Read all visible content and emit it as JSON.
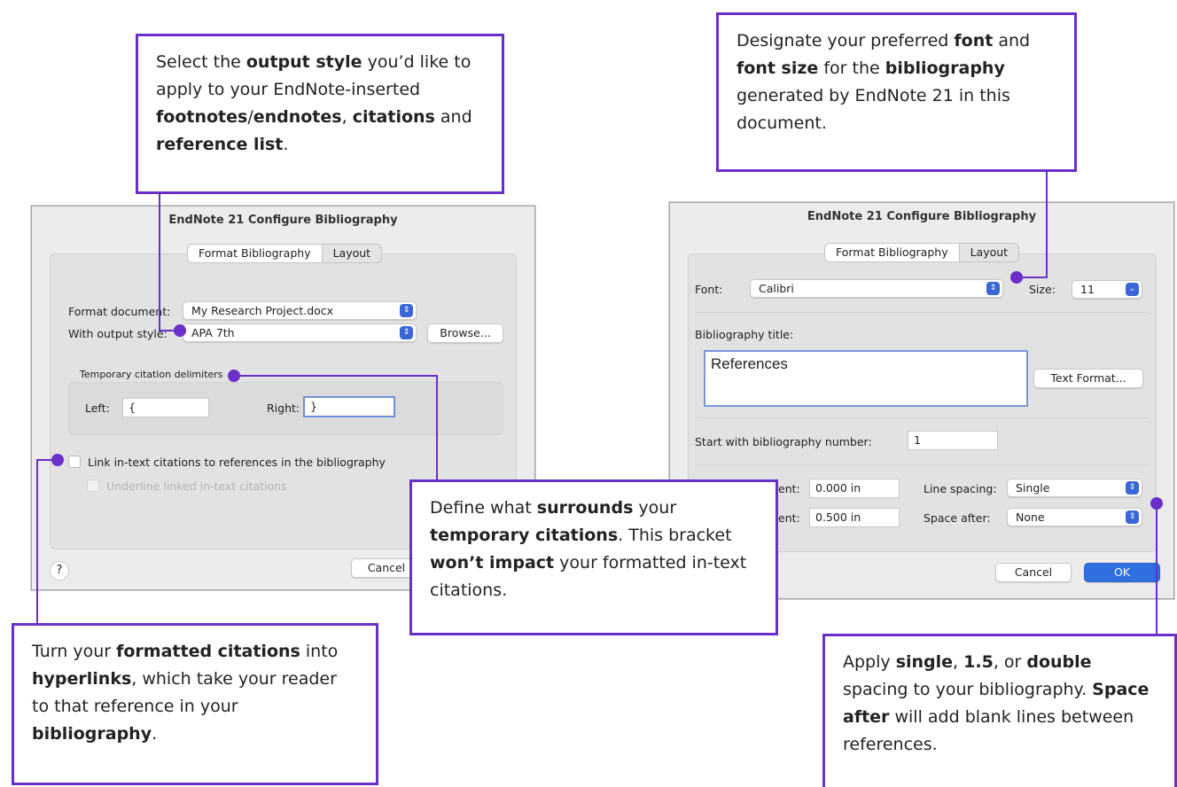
{
  "left_dialog": {
    "title": "EndNote 21 Configure Bibliography",
    "tabs": [
      "Format Bibliography",
      "Layout"
    ],
    "format_document_label": "Format document:",
    "format_document_value": "My Research Project.docx",
    "output_style_label": "With output style:",
    "output_style_value": "APA 7th",
    "browse_label": "Browse...",
    "delimiters_header": "Temporary citation delimiters",
    "left_label": "Left:",
    "left_value": "{",
    "right_label": "Right:",
    "right_value": "}",
    "link_checkbox_label": "Link in-text citations to references in the bibliography",
    "underline_checkbox_label": "Underline linked in-text citations",
    "help_label": "?",
    "cancel_label": "Cancel"
  },
  "right_dialog": {
    "title": "EndNote 21 Configure Bibliography",
    "tabs": [
      "Format Bibliography",
      "Layout"
    ],
    "font_label": "Font:",
    "font_value": "Calibri",
    "size_label": "Size:",
    "size_value": "11",
    "bib_title_label": "Bibliography title:",
    "bib_title_value": "References",
    "text_format_label": "Text Format...",
    "start_number_label": "Start with bibliography number:",
    "start_number_value": "1",
    "indent1_label": "ent:",
    "indent1_value": "0.000 in",
    "indent2_label": "ent:",
    "indent2_value": "0.500 in",
    "line_spacing_label": "Line spacing:",
    "line_spacing_value": "Single",
    "space_after_label": "Space after:",
    "space_after_value": "None",
    "cancel_label": "Cancel",
    "ok_label": "OK"
  },
  "stepper_icon": "up-down-chevron",
  "colors": {
    "accent": "#6b2fc9",
    "primary_button": "#2f6fe0"
  }
}
